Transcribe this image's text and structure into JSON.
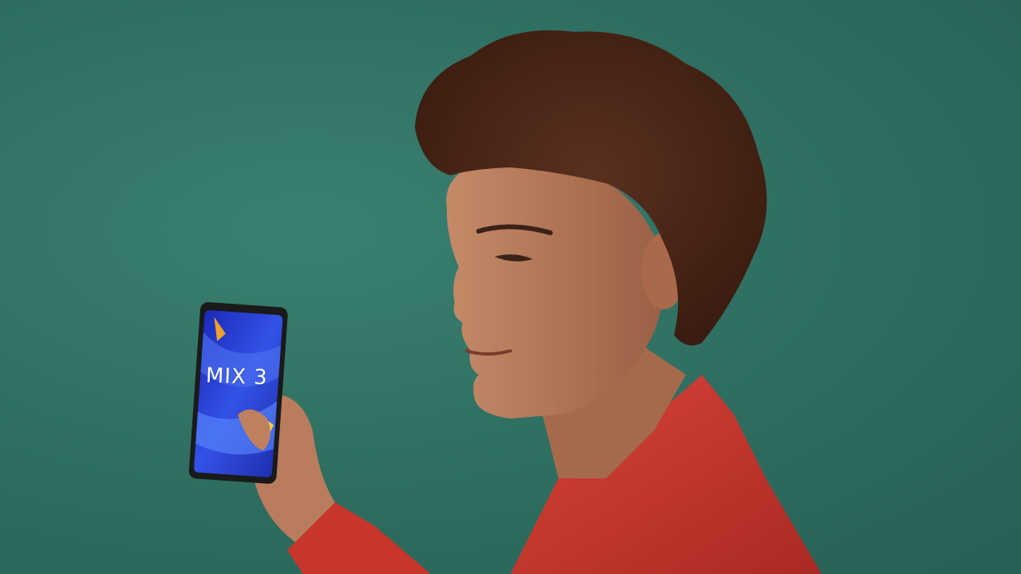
{
  "phone": {
    "screen_text": "MIX 3"
  },
  "colors": {
    "background": "#2f6f62",
    "jacket": "#c8352b",
    "hair": "#4a2617",
    "skin": "#b5785a",
    "phone_screen": "#2c3fd6"
  },
  "icons": [
    "person-figure",
    "smartphone-icon"
  ]
}
